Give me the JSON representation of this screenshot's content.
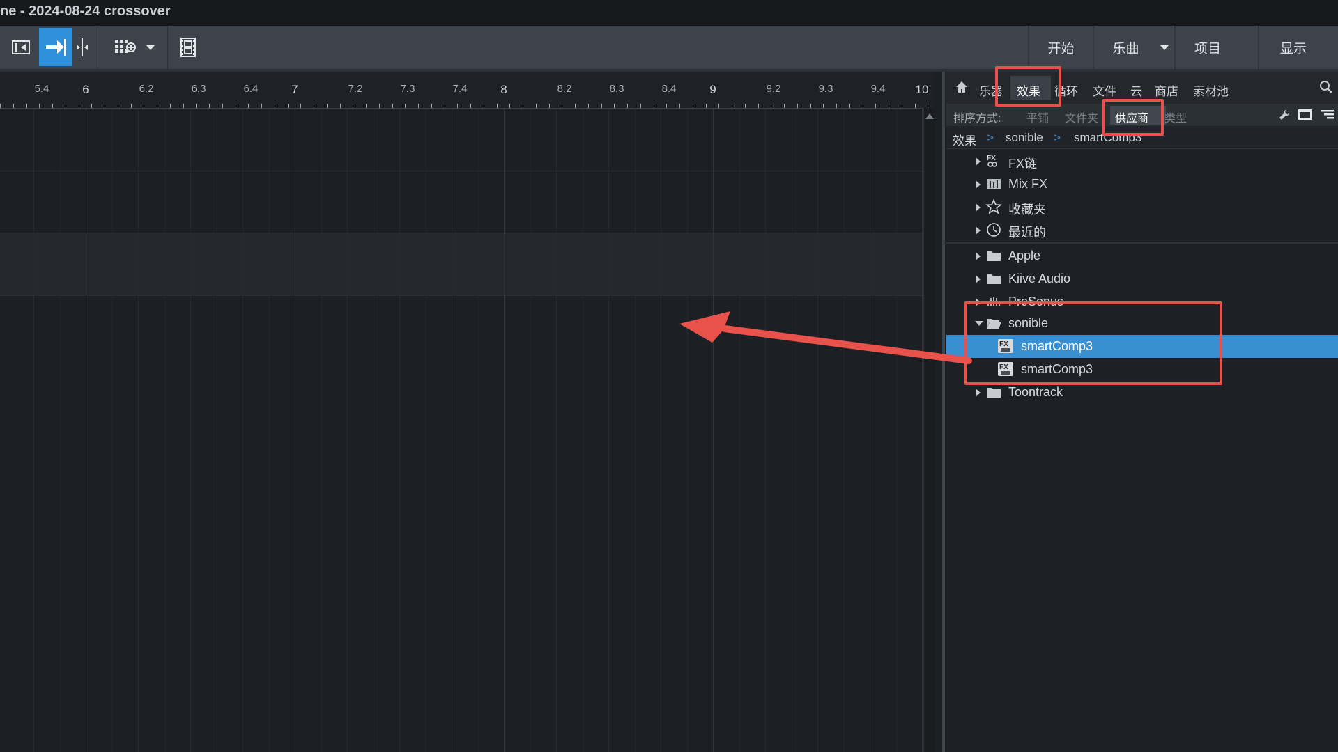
{
  "window": {
    "title": "ne - 2024-08-24 crossover"
  },
  "toolbar": {
    "tabs": [
      {
        "label": "开始"
      },
      {
        "label": "乐曲"
      },
      {
        "label": "项目"
      },
      {
        "label": "显示"
      }
    ]
  },
  "ruler": {
    "labels": [
      "5.4",
      "6",
      "6.2",
      "6.3",
      "6.4",
      "7",
      "7.2",
      "7.3",
      "7.4",
      "8",
      "8.2",
      "8.3",
      "8.4",
      "9",
      "9.2",
      "9.3",
      "9.4",
      "10"
    ]
  },
  "browser": {
    "nav_tabs": [
      "乐器",
      "效果",
      "循环",
      "文件",
      "云",
      "商店",
      "素材池"
    ],
    "selected_tab": "效果",
    "sort": {
      "label": "排序方式:",
      "options": [
        "平铺",
        "文件夹",
        "供应商",
        "类型"
      ],
      "selected": "供应商"
    },
    "breadcrumb": [
      "效果",
      "sonible",
      "smartComp3"
    ],
    "tree": [
      {
        "label": "FX链",
        "icon": "fx-chain-icon"
      },
      {
        "label": "Mix FX",
        "icon": "mix-fx-icon"
      },
      {
        "label": "收藏夹",
        "icon": "star-icon"
      },
      {
        "label": "最近的",
        "icon": "clock-icon"
      },
      {
        "label": "Apple",
        "icon": "folder-icon"
      },
      {
        "label": "Kiive Audio",
        "icon": "folder-icon"
      },
      {
        "label": "PreSonus",
        "icon": "presonus-icon"
      },
      {
        "label": "sonible",
        "icon": "folder-open-icon"
      },
      {
        "label": "smartComp3",
        "icon": "fx-vst-icon"
      },
      {
        "label": "smartComp3",
        "icon": "fx-au-icon"
      },
      {
        "label": "Toontrack",
        "icon": "folder-icon"
      }
    ]
  },
  "annotations": {
    "color": "#e8524a"
  },
  "colors": {
    "accent": "#2f8fd8",
    "selection": "#3a8fd0",
    "background": "#1c1f23"
  }
}
